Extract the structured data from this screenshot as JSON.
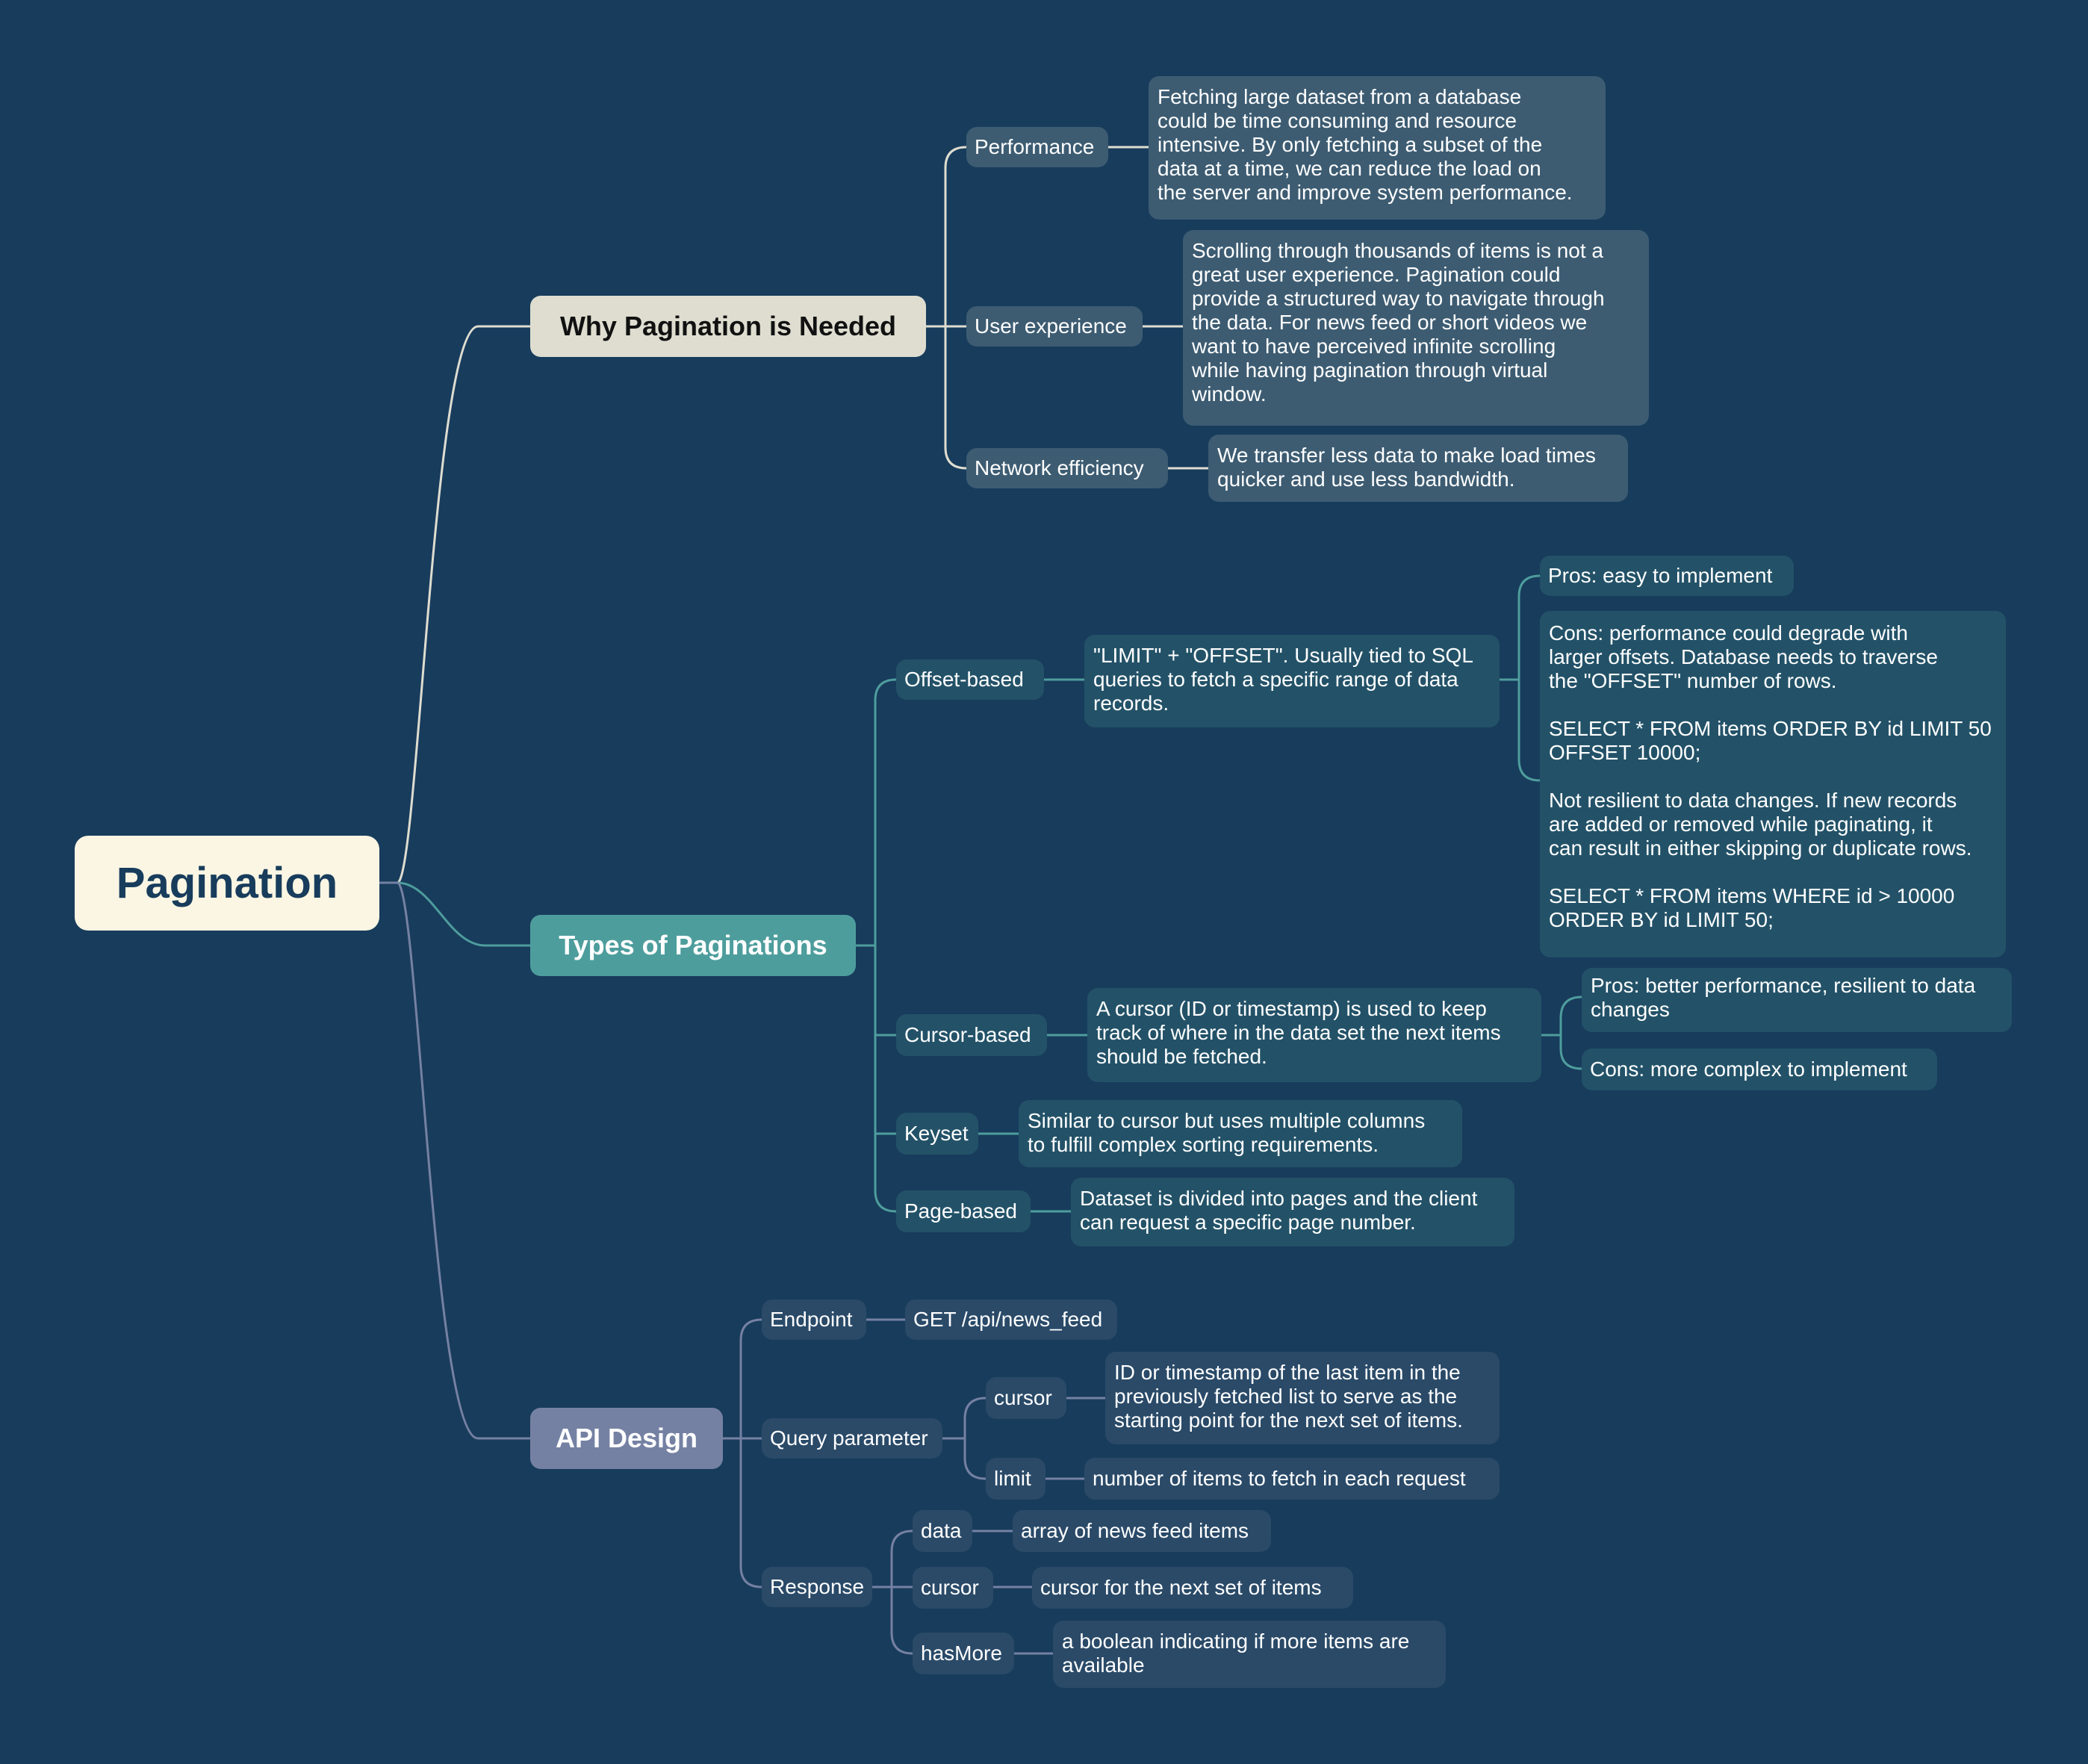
{
  "root": {
    "label": "Pagination"
  },
  "colors": {
    "background": "#183c5c",
    "branch1": "#deddd0",
    "branch2": "#4e9d9d",
    "branch3": "#7581a3"
  },
  "why": {
    "label": "Why Pagination is Needed",
    "items": [
      {
        "label": "Performance",
        "desc": "Fetching large dataset from a database\ncould be time consuming and resource\nintensive. By only fetching a subset of the\ndata at a time, we can reduce the load on\nthe server and improve system performance."
      },
      {
        "label": "User experience",
        "desc": "Scrolling through thousands of items is not a\ngreat user experience. Pagination could\nprovide a structured way to navigate through\nthe data. For news feed or short videos we\nwant to have perceived infinite scrolling\nwhile having pagination through virtual\nwindow."
      },
      {
        "label": "Network efficiency",
        "desc": "We transfer less data to make load times\nquicker and use less bandwidth."
      }
    ]
  },
  "types": {
    "label": "Types of Paginations",
    "items": [
      {
        "label": "Offset-based",
        "desc": "\"LIMIT\" + \"OFFSET\". Usually tied to SQL\nqueries to fetch a specific range of data\nrecords.",
        "pros": "Pros: easy to implement",
        "cons": "Cons: performance could degrade with\nlarger offsets. Database needs to traverse\nthe \"OFFSET\" number of rows.\n\nSELECT * FROM items ORDER BY id LIMIT 50\nOFFSET 10000;\n\nNot resilient to data changes. If new records\nare added or removed while paginating, it\ncan result in either skipping or duplicate rows.\n\nSELECT * FROM items WHERE id > 10000\nORDER BY id LIMIT 50;"
      },
      {
        "label": "Cursor-based",
        "desc": "A cursor (ID or timestamp) is used to keep\ntrack of where in the data set the next items\nshould be fetched.",
        "pros": "Pros: better performance, resilient to data\nchanges",
        "cons": "Cons: more complex to implement"
      },
      {
        "label": "Keyset",
        "desc": "Similar to cursor but uses multiple columns\nto fulfill complex sorting requirements."
      },
      {
        "label": "Page-based",
        "desc": "Dataset is divided into pages and the client\ncan request a specific page number."
      }
    ]
  },
  "api": {
    "label": "API Design",
    "endpoint": {
      "label": "Endpoint",
      "value": "GET /api/news_feed"
    },
    "query": {
      "label": "Query parameter",
      "cursor": {
        "label": "cursor",
        "desc": "ID or timestamp of the last item in the\npreviously fetched list to serve as the\nstarting point for the next set of items."
      },
      "limit": {
        "label": "limit",
        "desc": "number of items to fetch in each request"
      }
    },
    "response": {
      "label": "Response",
      "data": {
        "label": "data",
        "desc": "array of news feed items"
      },
      "cursor": {
        "label": "cursor",
        "desc": "cursor for the next set of items"
      },
      "hasMore": {
        "label": "hasMore",
        "desc": "a boolean indicating if more items are\navailable"
      }
    }
  }
}
